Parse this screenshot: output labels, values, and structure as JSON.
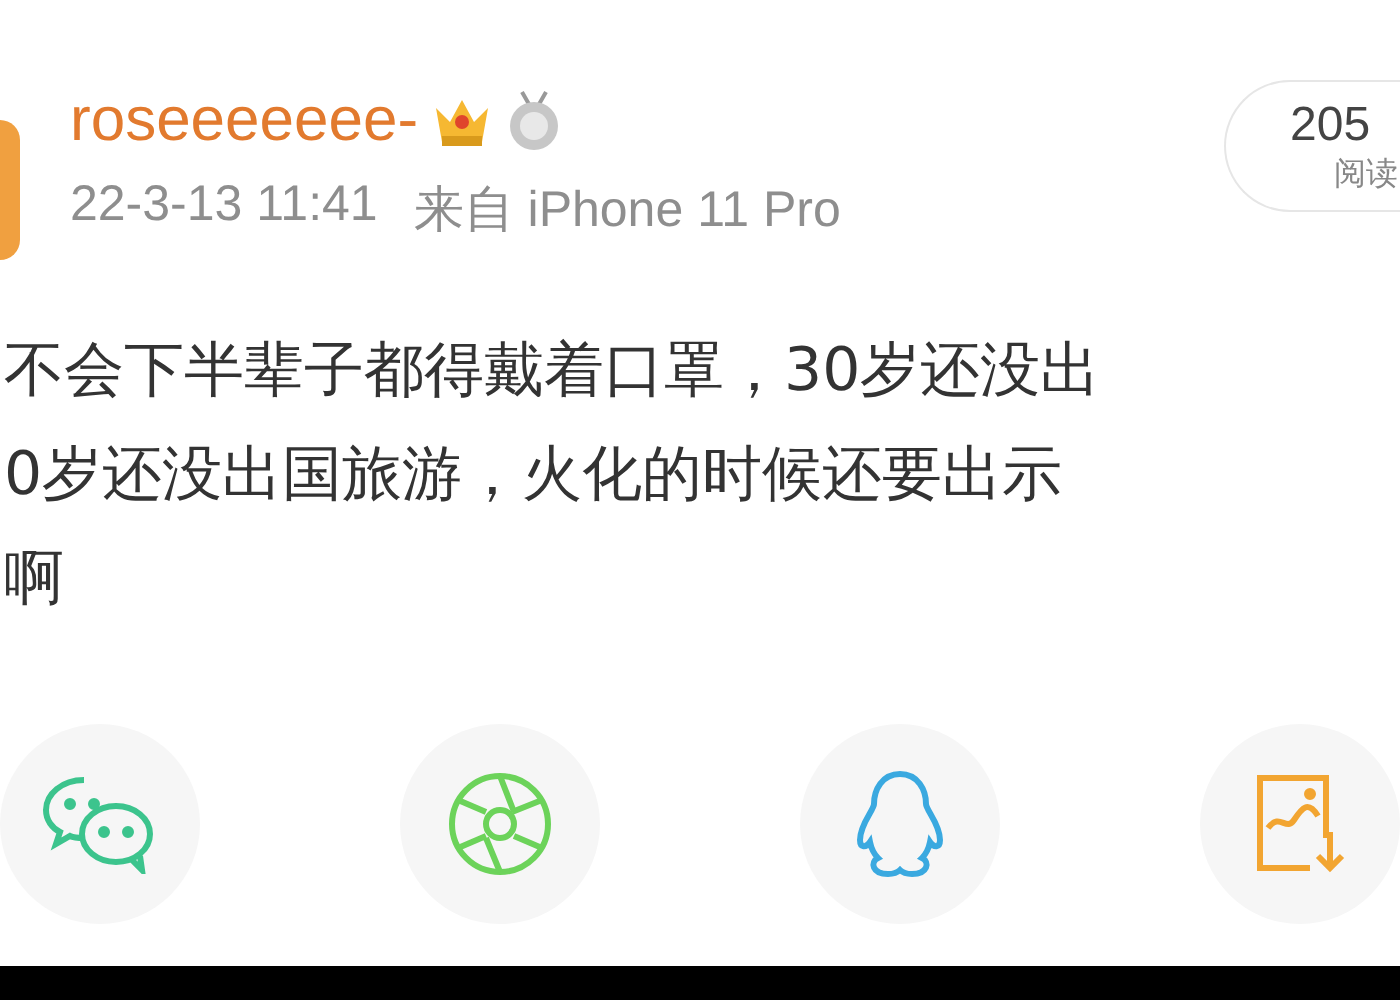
{
  "post": {
    "username": "roseeeeeee-",
    "time": "22-3-13 11:41",
    "source": "来自 iPhone 11 Pro",
    "read_count": "205",
    "read_label": "阅读",
    "lines": [
      "不会下半辈子都得戴着口罩，30岁还没出",
      "0岁还没出国旅游，火化的时候还要出示",
      "啊"
    ]
  },
  "share_buttons": [
    {
      "kind": "wechat"
    },
    {
      "kind": "moments"
    },
    {
      "kind": "qq"
    },
    {
      "kind": "save-image"
    }
  ]
}
